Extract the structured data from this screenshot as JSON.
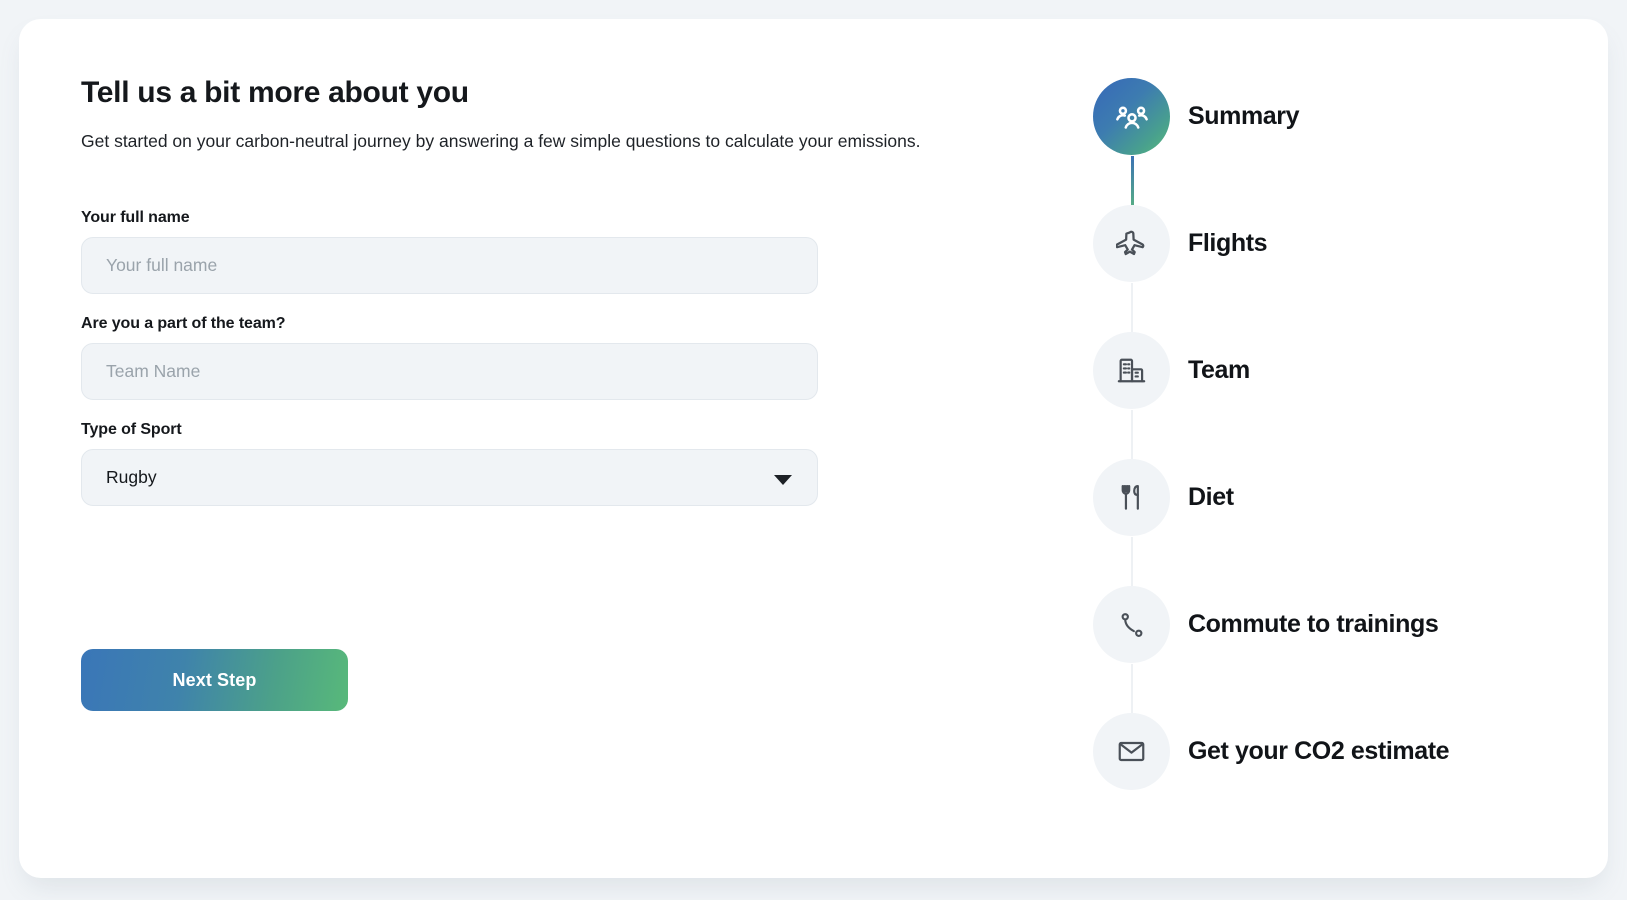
{
  "theme": {
    "page_background": "#f1f4f7",
    "card_background": "#ffffff",
    "accent_gradient_start": "#3a76b8",
    "accent_gradient_end": "#58b97a",
    "input_background": "#f1f4f7",
    "text_primary": "#15181c",
    "placeholder_color": "#9aa3ab"
  },
  "form": {
    "title": "Tell us a bit more about you",
    "subtitle": "Get started on your carbon-neutral journey by answering a few simple questions to calculate your emissions.",
    "fields": [
      {
        "label": "Your full name",
        "type": "text",
        "value": "",
        "placeholder": "Your full name"
      },
      {
        "label": "Are you a part of the team?",
        "type": "text",
        "value": "",
        "placeholder": "Team Name"
      },
      {
        "label": "Type of Sport",
        "type": "select",
        "value": "Rugby",
        "placeholder": "",
        "options": [
          "Rugby"
        ]
      }
    ],
    "submit_label": "Next Step"
  },
  "stepper": {
    "steps": [
      {
        "label": "Summary",
        "icon": "users-group-icon",
        "active": true
      },
      {
        "label": "Flights",
        "icon": "airplane-icon",
        "active": false
      },
      {
        "label": "Team",
        "icon": "building-icon",
        "active": false
      },
      {
        "label": "Diet",
        "icon": "cutlery-icon",
        "active": false
      },
      {
        "label": "Commute to trainings",
        "icon": "route-icon",
        "active": false
      },
      {
        "label": "Get your CO2 estimate",
        "icon": "envelope-icon",
        "active": false
      }
    ]
  }
}
